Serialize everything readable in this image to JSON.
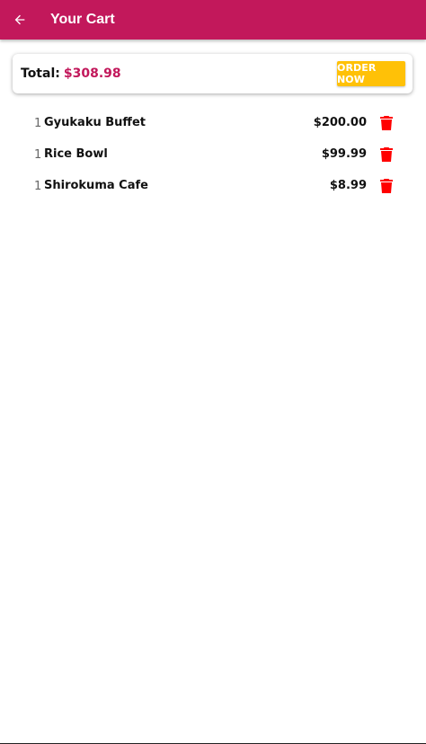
{
  "appbar": {
    "title": "Your Cart",
    "back_icon": "arrow-left-icon",
    "color": "#c2185b"
  },
  "summary": {
    "total_label": "Total:",
    "total_value": "$308.98",
    "order_button_label": "ORDER NOW",
    "order_button_color": "#ffc107",
    "total_value_color": "#c2185b"
  },
  "cart": {
    "items": [
      {
        "qty": "1",
        "name": "Gyukaku Buffet",
        "price": "$200.00"
      },
      {
        "qty": "1",
        "name": "Rice Bowl",
        "price": "$99.99"
      },
      {
        "qty": "1",
        "name": "Shirokuma Cafe",
        "price": "$8.99"
      }
    ],
    "delete_icon": "trash-icon",
    "delete_icon_color": "#ff0000"
  }
}
